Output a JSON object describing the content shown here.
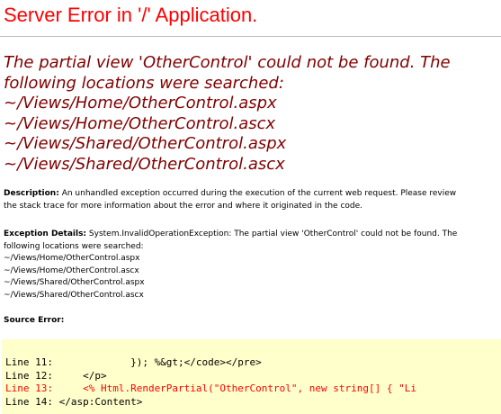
{
  "page": {
    "title": "Server Error in '/' Application.",
    "message_lines": [
      "The partial view 'OtherControl' could not be found. The",
      "following locations were searched:",
      "~/Views/Home/OtherControl.aspx",
      "~/Views/Home/OtherControl.ascx",
      "~/Views/Shared/OtherControl.aspx",
      "~/Views/Shared/OtherControl.ascx"
    ]
  },
  "description": {
    "label": "Description:",
    "line1": "An unhandled exception occurred during the execution of the current web request. Please review",
    "line2": "the stack trace for more information about the error and where it originated in the code."
  },
  "exception": {
    "label": "Exception Details:",
    "line1": "System.InvalidOperationException: The partial view 'OtherControl' could not be found. The",
    "lines": [
      "following locations were searched:",
      "~/Views/Home/OtherControl.aspx",
      "~/Views/Home/OtherControl.ascx",
      "~/Views/Shared/OtherControl.aspx",
      "~/Views/Shared/OtherControl.ascx"
    ]
  },
  "source_error": {
    "label": "Source Error:",
    "lines": [
      "Line 11:             }); %&gt;</code></pre>",
      "Line 12:     </p>",
      "Line 13:     <% Html.RenderPartial(\"OtherControl\", new string[] { \"Li",
      "Line 14: </asp:Content>"
    ],
    "error_line_color": "#ff0000"
  },
  "colors": {
    "title": "#ff0000",
    "message": "#800000",
    "code_background": "#ffffcc"
  }
}
